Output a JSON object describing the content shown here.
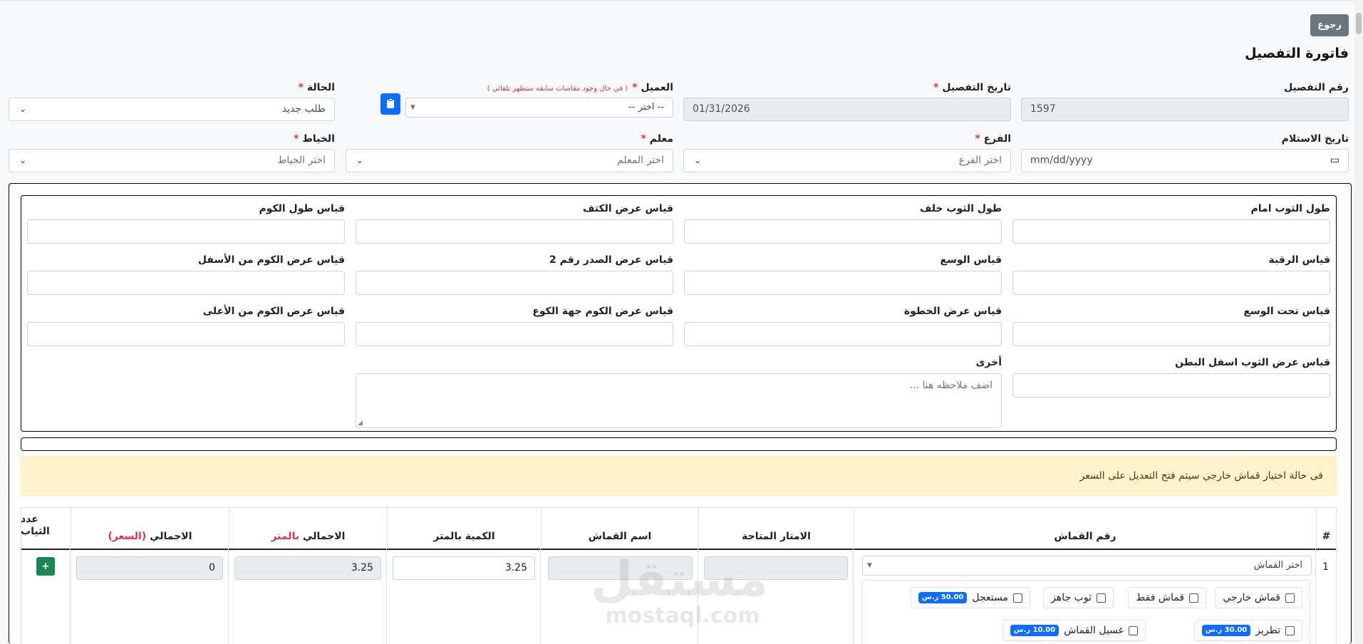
{
  "header": {
    "back_label": "رجوع",
    "title": "فاتورة التفصيل"
  },
  "form": {
    "invoice_no": {
      "label": "رقم التفصيل",
      "value": "1597"
    },
    "date": {
      "label": "تاريخ التفصيل",
      "required": "*",
      "value": "01/31/2026"
    },
    "client": {
      "label": "العميل",
      "required": "*",
      "note": "( في حال وجود مقاسات سابقه ستظهر تلقائي )",
      "value": "-- اختر --"
    },
    "status": {
      "label": "الحالة",
      "required": "*",
      "value": "طلب جديد"
    },
    "receive_date": {
      "label": "تاريخ الاستلام",
      "placeholder": "mm/dd/yyyy"
    },
    "branch": {
      "label": "الفرع",
      "required": "*",
      "placeholder": "اختر الفرع"
    },
    "teacher": {
      "label": "معلم",
      "required": "*",
      "placeholder": "اختر المعلم"
    },
    "tailor": {
      "label": "الخياط",
      "required": "*",
      "placeholder": "اختر الخياط"
    }
  },
  "measurements": {
    "front_length": "طول الثوب امام",
    "back_length": "طول الثوب خلف",
    "shoulder_width": "قياس عرض الكتف",
    "sleeve_length": "قياس طول الكوم",
    "neck": "قياس الرقبة",
    "waist": "قياس الوسع",
    "chest_width_2": "قياس عرض الصدر رقم 2",
    "sleeve_bottom": "قياس عرض الكوم من الأسفل",
    "under_waist": "قياس تحت الوسع",
    "step_width": "قياس عرض الخطوة",
    "sleeve_elbow": "قياس عرض الكوم جهة الكوع",
    "sleeve_top": "قياس عرض الكوم من الأعلى",
    "belly_bottom": "قياس عرض الثوب اسفل البطن",
    "other": {
      "label": "أخرى",
      "placeholder": "اضف ملاحظه هنا ..."
    }
  },
  "alert_text": "فى حالة اختيار قماش خارجي سيتم فتح التعديل على السعر",
  "table": {
    "headers": {
      "num": "#",
      "fabric_no": "رقم القماش",
      "available_meters": "الامتار المتاحة",
      "fabric_name": "اسم القماش",
      "qty_meter": "الكمية بالمتر",
      "total_meter_a": "الاجمالي",
      "total_meter_b": "بالمتر",
      "total_price_a": "الاجمالي",
      "total_price_b": "(السعر)",
      "pieces_a": "عدد",
      "pieces_b": "الثياب"
    },
    "row": {
      "num": "1",
      "fabric_select": "اختر القماش",
      "qty": "3.25",
      "total_meter": "3.25",
      "total_price": "0",
      "plus": "+"
    },
    "options": {
      "external": "قماش خارجي",
      "fabric_only": "قماش فقط",
      "ready": "ثوب جاهز",
      "urgent": "مستعجل",
      "urgent_price": "50.00 ر.س",
      "embroidery": "تطريز",
      "embroidery_price": "30.00 ر.س",
      "wash": "غسيل القماش",
      "wash_price": "10.00 ر.س"
    }
  },
  "watermark": {
    "ar": "مستقل",
    "en": "mostaql.com"
  },
  "colors": {
    "required": "#dc3545",
    "primary": "#0d6efd",
    "success": "#198754",
    "alert_bg": "#fff3cd"
  }
}
